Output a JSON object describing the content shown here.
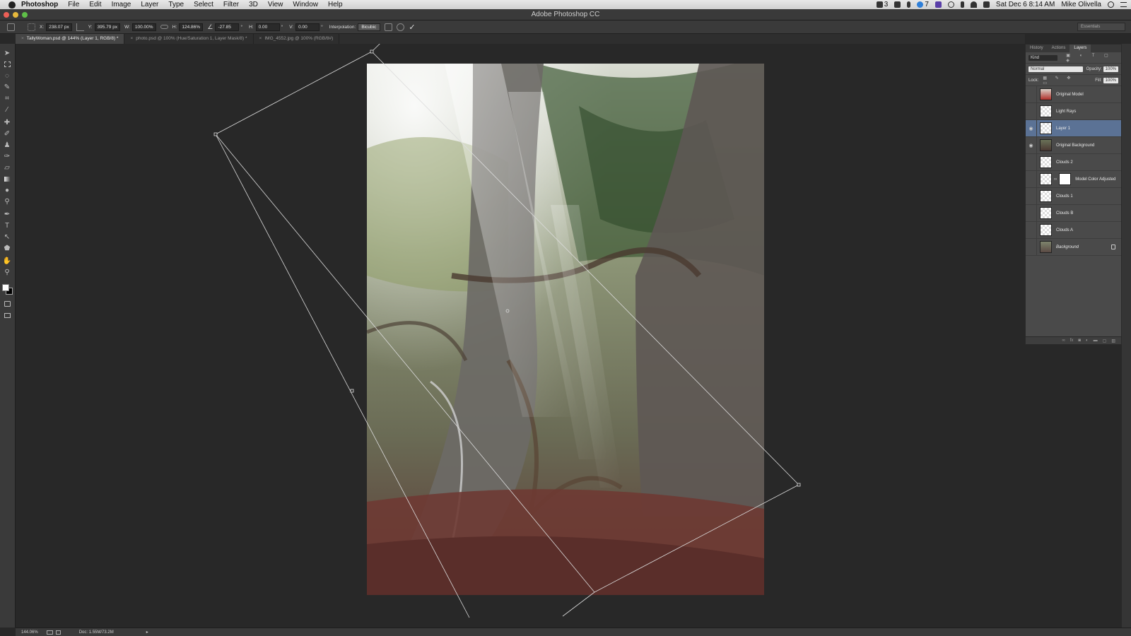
{
  "menubar": {
    "app": "Photoshop",
    "items": [
      "File",
      "Edit",
      "Image",
      "Layer",
      "Type",
      "Select",
      "Filter",
      "3D",
      "View",
      "Window",
      "Help"
    ],
    "status_right": [
      "3",
      "7"
    ],
    "datetime": "Sat Dec 6  8:14 AM",
    "user": "Mike Olivella"
  },
  "window": {
    "title": "Adobe Photoshop CC"
  },
  "options_bar": {
    "x_label": "X:",
    "x_value": "238.07 px",
    "y_label": "Y:",
    "y_value": "395.79 px",
    "w_label": "W:",
    "w_value": "100.00%",
    "h_label": "H:",
    "h_value": "124.86%",
    "angle_value": "-27.85",
    "hskew_label": "H:",
    "hskew_value": "0.00",
    "vskew_label": "V:",
    "vskew_value": "0.00",
    "interpolation_label": "Interpolation:",
    "interpolation_value": "Bicubic",
    "workspace": "Essentials"
  },
  "doc_tabs": [
    {
      "label": "TallyWoman.psd @ 144% (Layer 1, RGB/8) *",
      "active": true
    },
    {
      "label": "photo.psd @ 100% (Hue/Saturation 1, Layer Mask/8) *",
      "active": false
    },
    {
      "label": "IMG_4552.jpg @ 100% (RGB/8#)",
      "active": false
    }
  ],
  "layers_panel": {
    "tabs": [
      "History",
      "Actions",
      "Layers"
    ],
    "active_tab": "Layers",
    "filter_kind": "Kind",
    "blend_mode": "Normal",
    "opacity_label": "Opacity:",
    "opacity_value": "100%",
    "lock_label": "Lock:",
    "fill_label": "Fill:",
    "fill_value": "100%",
    "layers": [
      {
        "name": "Original Model",
        "visible": false,
        "selected": false,
        "thumb": "model"
      },
      {
        "name": "Light Rays",
        "visible": false,
        "selected": false,
        "thumb": "checker"
      },
      {
        "name": "Layer 1",
        "visible": true,
        "selected": true,
        "thumb": "checker"
      },
      {
        "name": "Original Background",
        "visible": true,
        "selected": false,
        "thumb": "forest"
      },
      {
        "name": "Clouds 2",
        "visible": false,
        "selected": false,
        "thumb": "checker"
      },
      {
        "name": "Model Color Adjusted",
        "visible": false,
        "selected": false,
        "thumb": "checker-mask"
      },
      {
        "name": "Clouds 1",
        "visible": false,
        "selected": false,
        "thumb": "checker"
      },
      {
        "name": "Clouds B",
        "visible": false,
        "selected": false,
        "thumb": "checker"
      },
      {
        "name": "Clouds A",
        "visible": false,
        "selected": false,
        "thumb": "checker"
      },
      {
        "name": "Background",
        "visible": false,
        "selected": false,
        "thumb": "forest",
        "locked": true
      }
    ]
  },
  "status_bar": {
    "zoom": "144.06%",
    "doc": "Doc: 1.55M/73.2M"
  }
}
